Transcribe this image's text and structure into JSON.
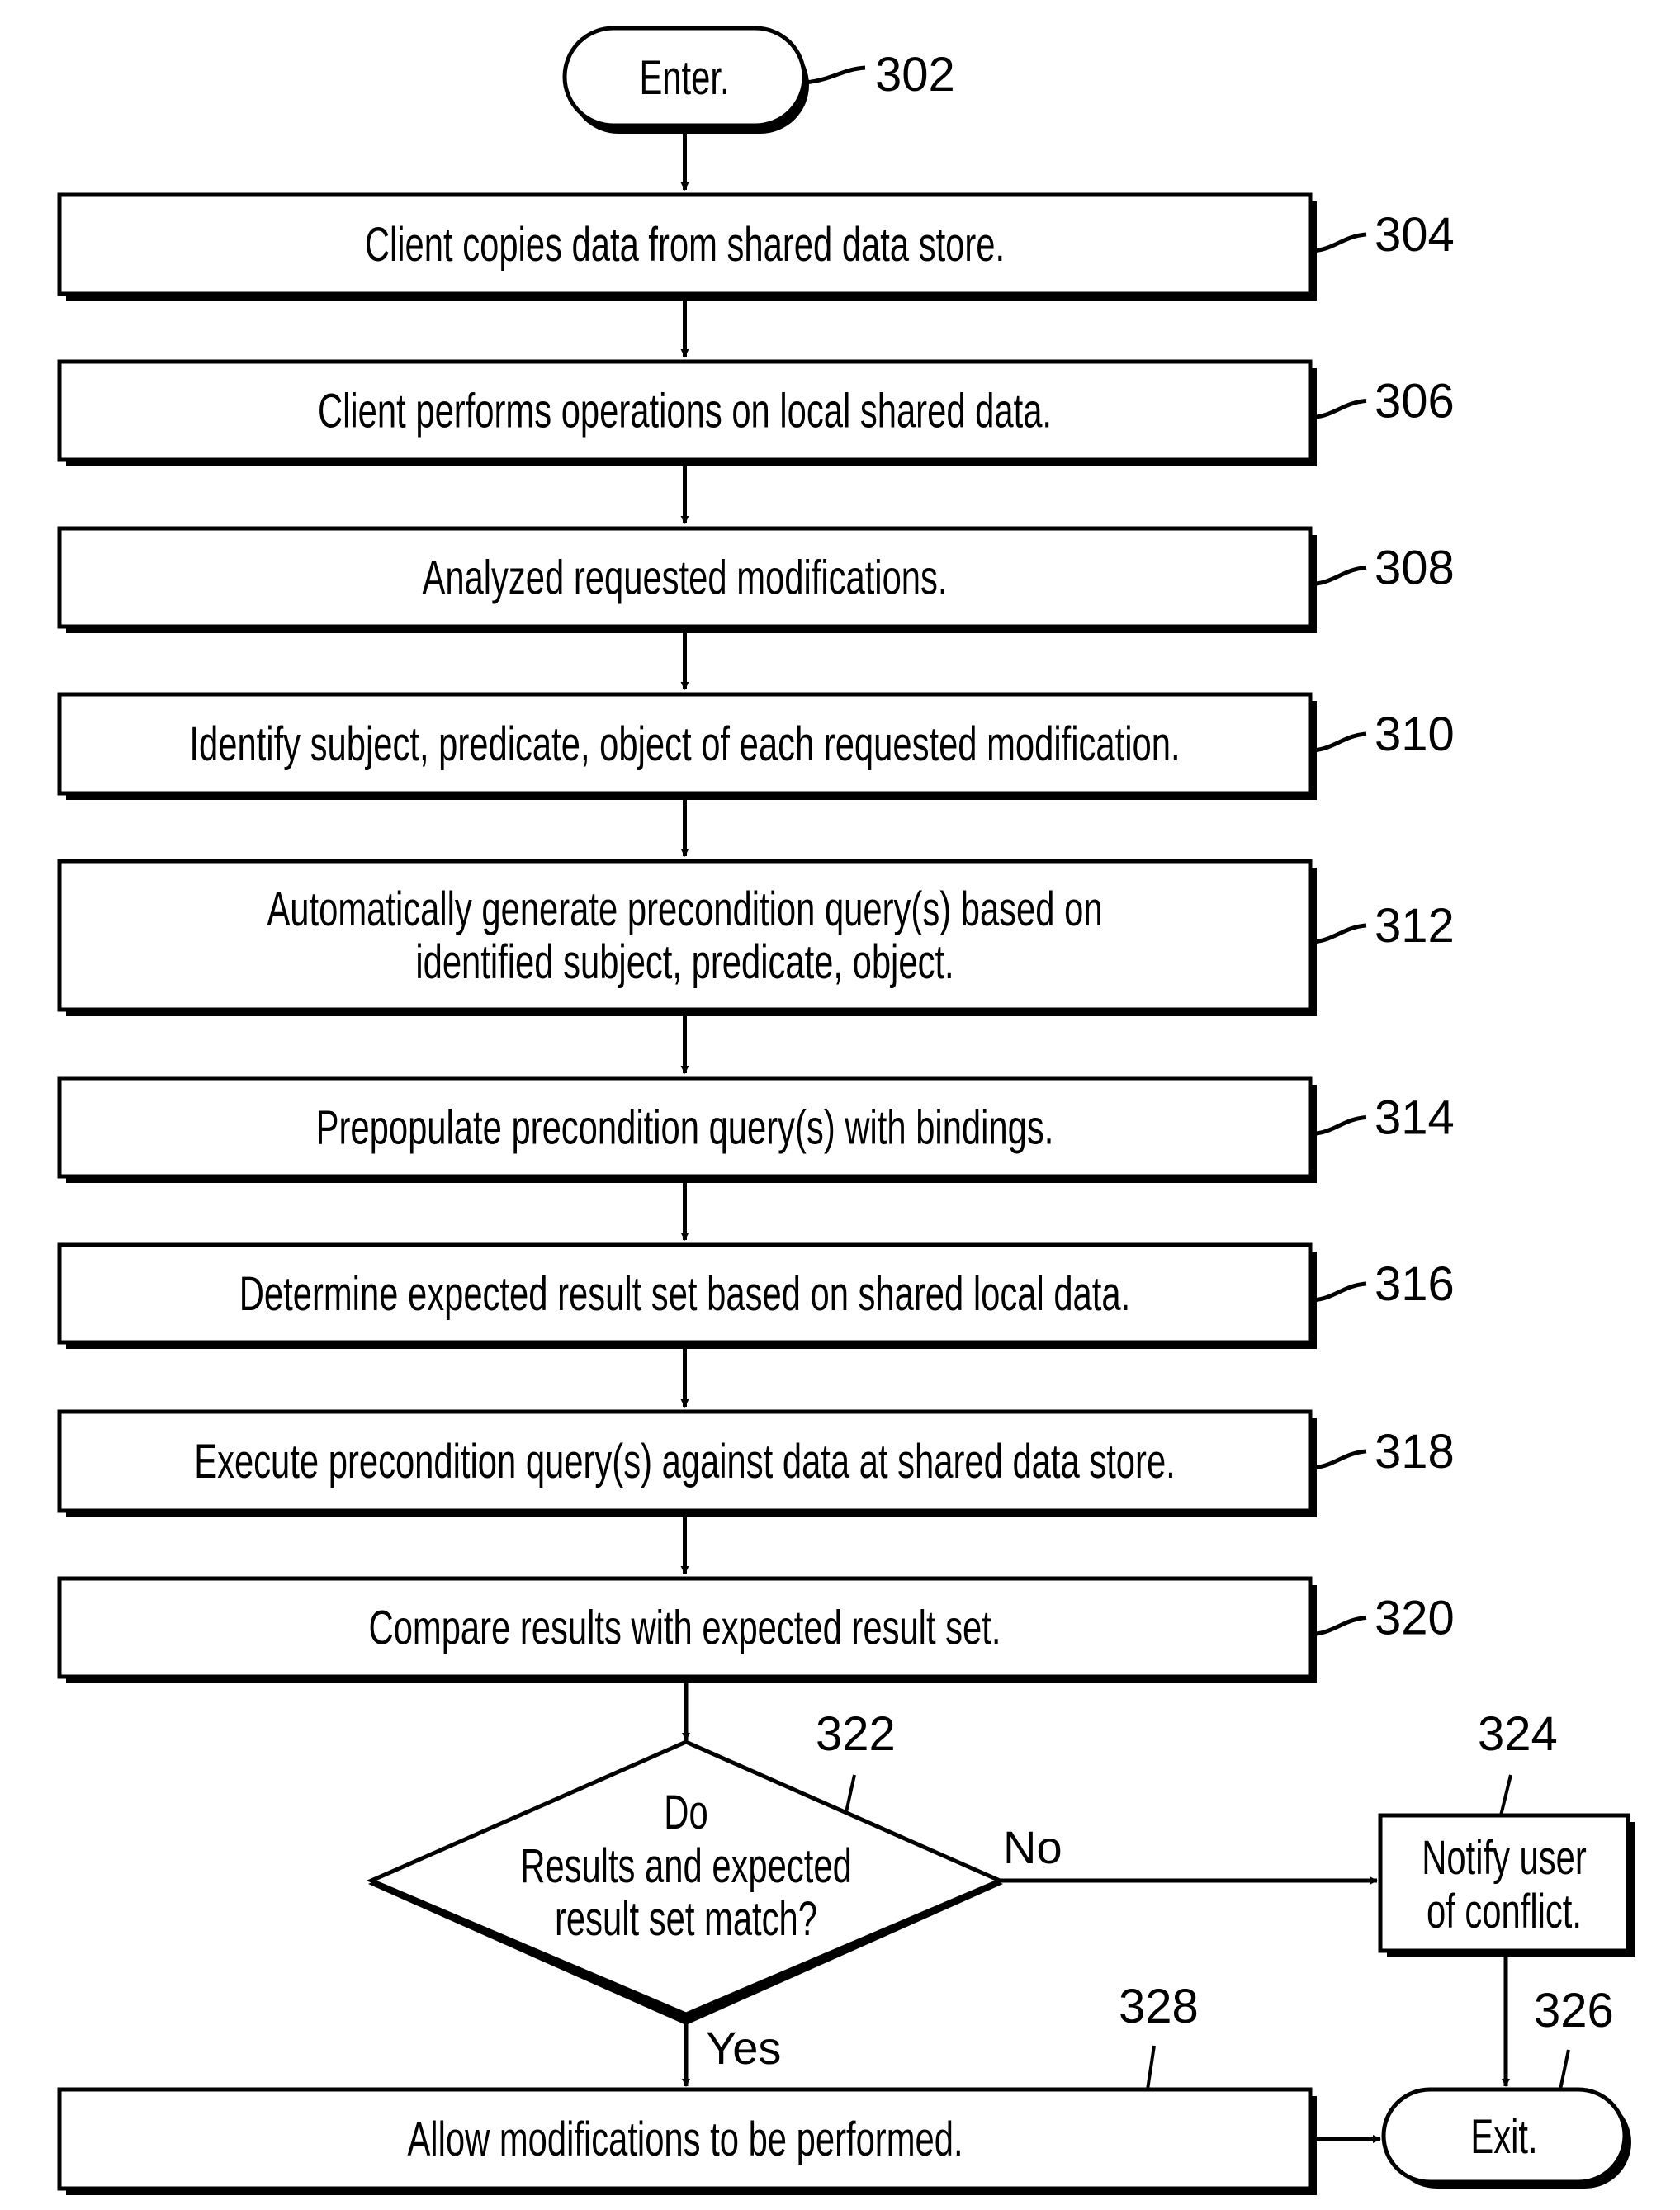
{
  "figure": {
    "terminals": {
      "enter": {
        "label": "Enter.",
        "ref": "302"
      },
      "exit": {
        "label": "Exit.",
        "ref": "326"
      }
    },
    "steps": [
      {
        "ref": "304",
        "lines": [
          "Client copies data from shared data store."
        ]
      },
      {
        "ref": "306",
        "lines": [
          "Client performs operations on local shared data."
        ]
      },
      {
        "ref": "308",
        "lines": [
          "Analyzed requested modifications."
        ]
      },
      {
        "ref": "310",
        "lines": [
          "Identify subject, predicate, object of each requested modification."
        ]
      },
      {
        "ref": "312",
        "lines": [
          "Automatically generate precondition query(s) based on",
          "identified subject, predicate, object."
        ]
      },
      {
        "ref": "314",
        "lines": [
          "Prepopulate precondition query(s) with bindings."
        ]
      },
      {
        "ref": "316",
        "lines": [
          "Determine expected result set based on shared local data."
        ]
      },
      {
        "ref": "318",
        "lines": [
          "Execute precondition query(s) against data at shared data store."
        ]
      },
      {
        "ref": "320",
        "lines": [
          "Compare results with expected result set."
        ]
      }
    ],
    "decision": {
      "ref": "322",
      "lines": [
        "Do",
        "Results and expected",
        "result set match?"
      ],
      "no_label": "No",
      "yes_label": "Yes"
    },
    "notify": {
      "ref": "324",
      "lines": [
        "Notify user",
        "of conflict."
      ]
    },
    "allow": {
      "ref": "328",
      "lines": [
        "Allow modifications to be performed."
      ]
    }
  }
}
